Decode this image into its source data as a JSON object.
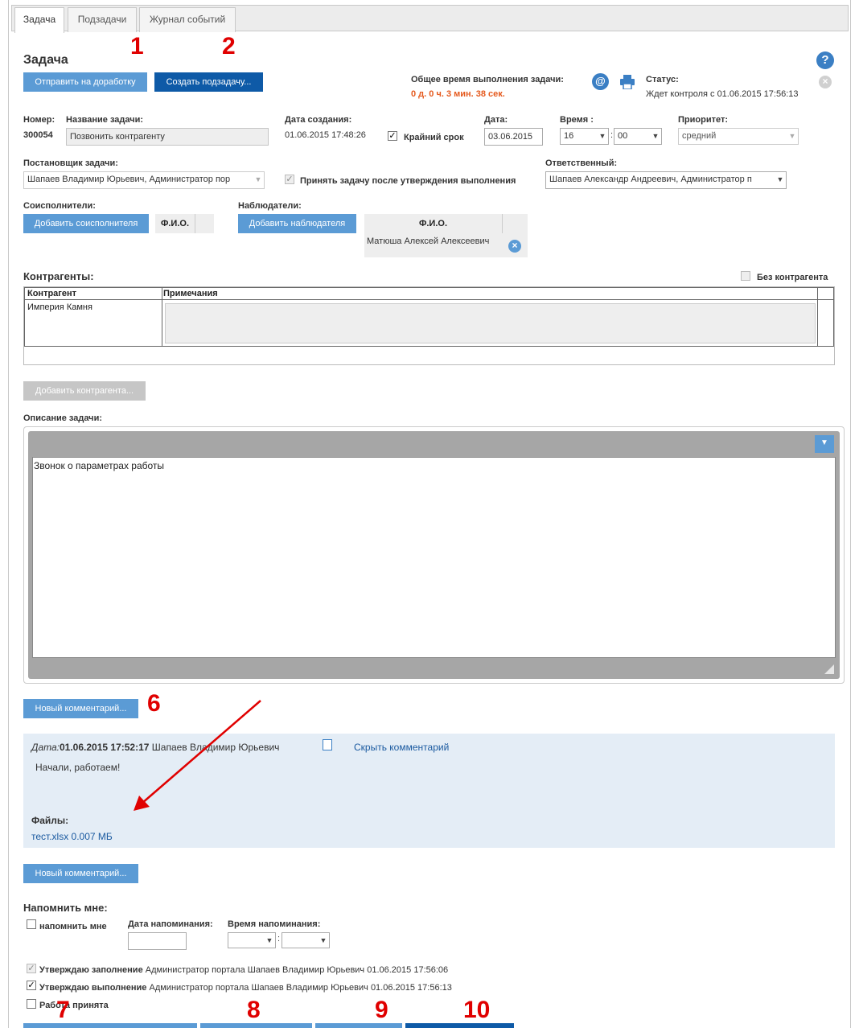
{
  "tabs": [
    "Задача",
    "Подзадачи",
    "Журнал событий"
  ],
  "page_title": "Задача",
  "actions": {
    "rework": "Отправить на доработку",
    "subtask": "Создать подзадачу..."
  },
  "timing": {
    "label": "Общее время выполнения задачи:",
    "value": "0 д. 0 ч. 3 мин. 38 сек."
  },
  "status": {
    "label": "Статус:",
    "value": "Ждет контроля с 01.06.2015 17:56:13"
  },
  "icons": {
    "email": "email-icon",
    "print": "print-icon",
    "help": "help-icon",
    "close": "close-icon",
    "edit": "edit-note-icon"
  },
  "fields": {
    "number_label": "Номер:",
    "number": "300054",
    "name_label": "Название задачи:",
    "name": "Позвонить контрагенту",
    "created_label": "Дата создания:",
    "created": "01.06.2015 17:48:26",
    "deadline_label": "Крайний срок",
    "date_label": "Дата:",
    "date": "03.06.2015",
    "time_label": "Время :",
    "hour": "16",
    "minute": "00",
    "priority_label": "Приоритет:",
    "priority": "средний",
    "author_label": "Постановщик задачи:",
    "author": "Шапаев Владимир Юрьевич, Администратор пор",
    "accept_label": "Принять задачу после утверждения выполнения",
    "responsible_label": "Ответственный:",
    "responsible": "Шапаев Александр Андреевич, Администратор п"
  },
  "coexecutors": {
    "label": "Соисполнители:",
    "add": "Добавить соисполнителя",
    "col": "Ф.И.О."
  },
  "observers": {
    "label": "Наблюдатели:",
    "add": "Добавить наблюдателя",
    "col": "Ф.И.О.",
    "rows": [
      "Матюша Алексей Алексеевич"
    ]
  },
  "contractors": {
    "label": "Контрагенты:",
    "none_label": "Без контрагента",
    "col_name": "Контрагент",
    "col_note": "Примечания",
    "rows": [
      {
        "name": "Империя Камня",
        "note": ""
      }
    ],
    "add": "Добавить контрагента..."
  },
  "description": {
    "label": "Описание задачи:",
    "text": "Звонок о параметрах работы"
  },
  "new_comment": "Новый комментарий...",
  "comment": {
    "date_label": "Дата:",
    "date": "01.06.2015 17:52:17",
    "author": "Шапаев Владимир Юрьевич",
    "hide": "Скрыть комментарий",
    "text": "Начали, работаем!",
    "files_label": "Файлы:",
    "file": "тест.xlsx 0.007 МБ"
  },
  "remind": {
    "title": "Напомнить мне:",
    "check": "напомнить мне",
    "date_label": "Дата напоминания:",
    "time_label": "Время напоминания:"
  },
  "approvals": [
    {
      "label": "Утверждаю заполнение",
      "info": "Администратор портала Шапаев Владимир Юрьевич 01.06.2015 17:56:06"
    },
    {
      "label": "Утверждаю выполнение",
      "info": "Администратор портала Шапаев Владимир Юрьевич 01.06.2015 17:56:13"
    },
    {
      "label": "Работа принята",
      "info": ""
    }
  ],
  "annotations": [
    "1",
    "2",
    "6",
    "7",
    "8",
    "9",
    "10"
  ]
}
